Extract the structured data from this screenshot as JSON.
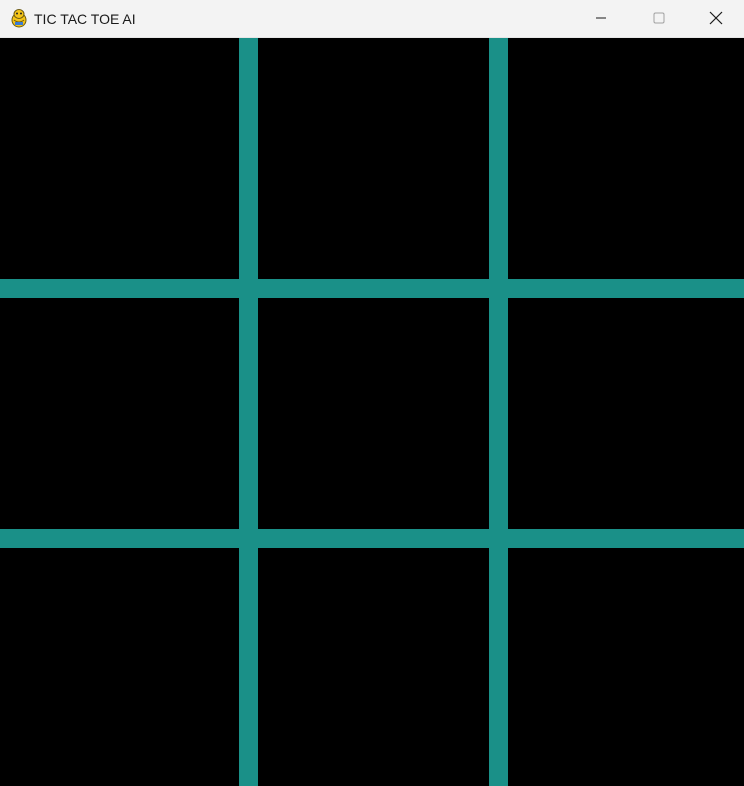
{
  "window": {
    "title": "TIC TAC TOE AI",
    "app_icon": "pygame-snake-icon",
    "controls": {
      "minimize": "minimize-icon",
      "maximize": "maximize-icon",
      "close": "close-icon"
    }
  },
  "game": {
    "background_color": "#000000",
    "line_color": "#1a9088",
    "board": [
      [
        "",
        "",
        ""
      ],
      [
        "",
        "",
        ""
      ],
      [
        "",
        "",
        ""
      ]
    ]
  }
}
